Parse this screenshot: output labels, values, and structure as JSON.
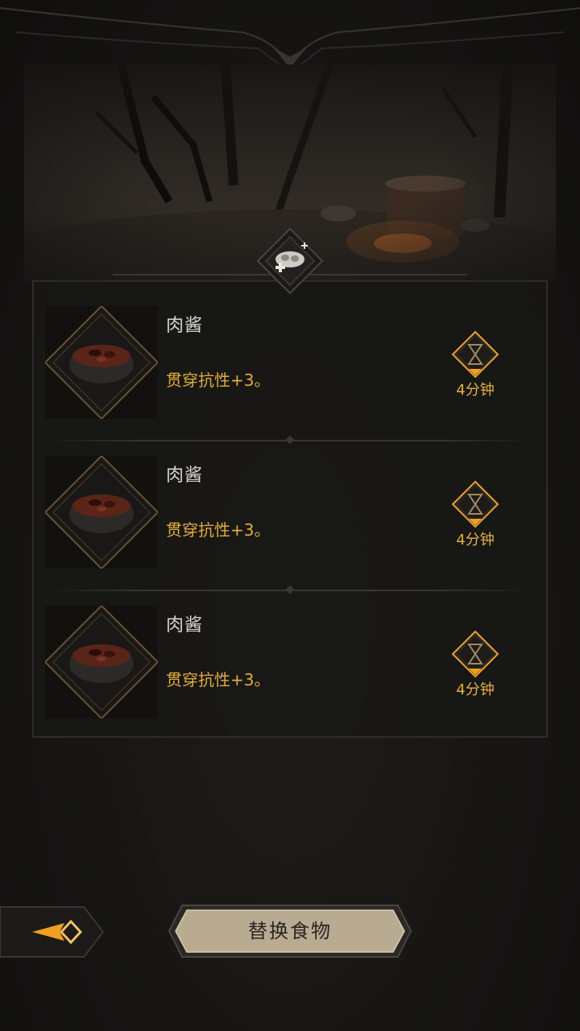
{
  "colors": {
    "accent_gold": "#e0ad3a",
    "timer_gold": "#e8b13f",
    "text_light": "#d9d6d0",
    "button_fill": "#b9ab92",
    "background": "#161514"
  },
  "header": {
    "emblem_icon": "food-buff-icon"
  },
  "food_list": [
    {
      "name": "肉酱",
      "effect": "贯穿抗性+3。",
      "duration": "4分钟",
      "image_icon": "meat-sauce-bowl-icon",
      "timer_icon": "hourglass-icon"
    },
    {
      "name": "肉酱",
      "effect": "贯穿抗性+3。",
      "duration": "4分钟",
      "image_icon": "meat-sauce-bowl-icon",
      "timer_icon": "hourglass-icon"
    },
    {
      "name": "肉酱",
      "effect": "贯穿抗性+3。",
      "duration": "4分钟",
      "image_icon": "meat-sauce-bowl-icon",
      "timer_icon": "hourglass-icon"
    }
  ],
  "footer": {
    "back_icon": "back-arrow-icon",
    "replace_button_label": "替换食物"
  }
}
